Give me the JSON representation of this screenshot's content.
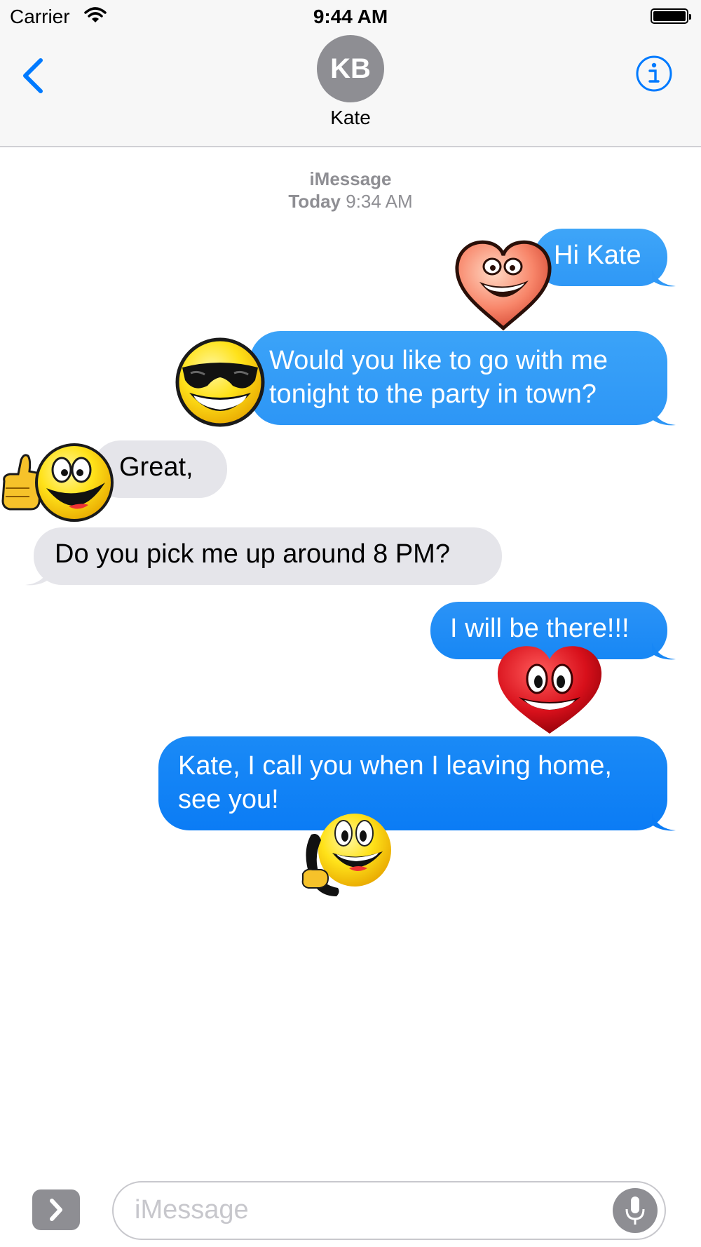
{
  "status_bar": {
    "carrier": "Carrier",
    "time": "9:44 AM"
  },
  "nav": {
    "avatar_initials": "KB",
    "contact_name": "Kate"
  },
  "thread_meta": {
    "service": "iMessage",
    "day": "Today",
    "time": "9:34 AM"
  },
  "messages": [
    {
      "direction": "outgoing",
      "text": "Hi Kate",
      "sticker": "heart-face-icon"
    },
    {
      "direction": "outgoing",
      "lines": [
        "Would you like to go with me",
        "tonight to the party in town?"
      ],
      "sticker": "sunglasses-smiley-icon"
    },
    {
      "direction": "incoming",
      "text": "Great,",
      "sticker": "thumbs-up-smiley-icon"
    },
    {
      "direction": "incoming",
      "text": "Do you pick me up around 8 PM?"
    },
    {
      "direction": "outgoing",
      "text": "I will be there!!!",
      "sticker": "red-heart-face-icon"
    },
    {
      "direction": "outgoing",
      "lines": [
        "Kate, I call you when I leaving home,",
        "see you!"
      ],
      "sticker": "phone-smiley-icon"
    }
  ],
  "input": {
    "placeholder": "iMessage"
  },
  "colors": {
    "accent": "#007aff",
    "outgoing_bubble_top": "#35a0f7",
    "outgoing_bubble_bottom": "#0b7cf5",
    "incoming_bubble": "#e5e5ea",
    "meta_text": "#8e8e93"
  }
}
